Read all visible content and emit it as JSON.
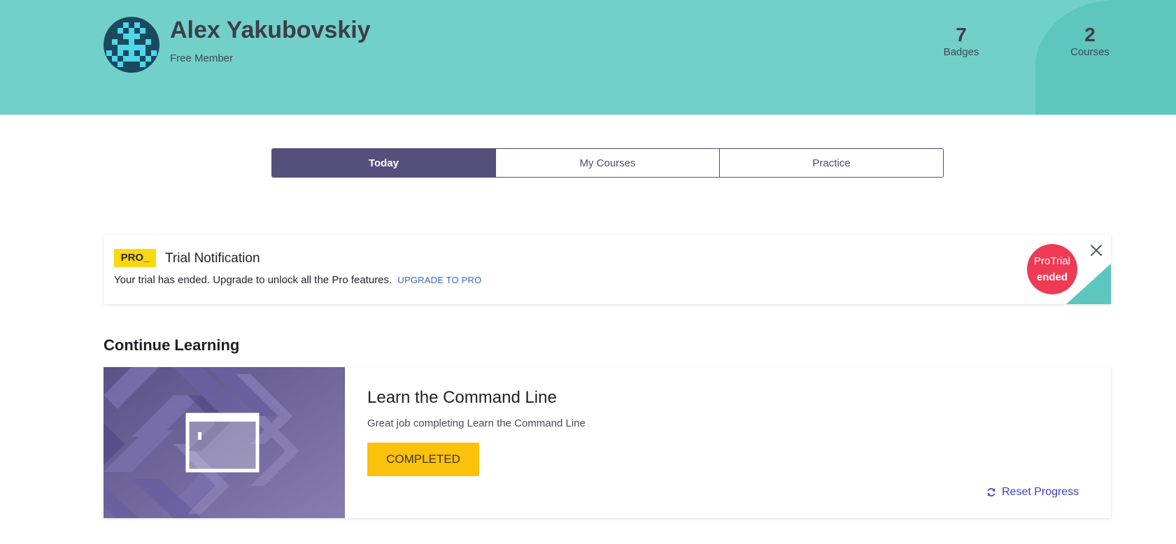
{
  "header": {
    "user_name": "Alex Yakubovskiy",
    "membership": "Free Member",
    "stats": [
      {
        "value": "7",
        "label": "Badges"
      },
      {
        "value": "2",
        "label": "Courses"
      }
    ]
  },
  "tabs": [
    {
      "label": "Today",
      "active": true
    },
    {
      "label": "My Courses",
      "active": false
    },
    {
      "label": "Practice",
      "active": false
    }
  ],
  "notification": {
    "badge": "PRO_",
    "title": "Trial Notification",
    "message": "Your trial has ended. Upgrade to unlock all the Pro features.",
    "link_label": "UPGRADE TO PRO",
    "status_line1": "ProTrial",
    "status_line2": "ended",
    "close_icon": "close-icon"
  },
  "continue_learning": {
    "section_title": "Continue Learning",
    "course": {
      "title": "Learn the Command Line",
      "description": "Great job completing Learn the Command Line",
      "status_button": "COMPLETED",
      "reset_label": "Reset Progress",
      "reset_icon": "refresh-icon"
    }
  },
  "colors": {
    "header_teal": "#72d0ca",
    "tab_active": "#554f7c",
    "pro_yellow": "#fcd80f",
    "trial_red": "#ef3a55",
    "completed_yellow": "#fbc10b",
    "link_blue": "#3a63cc",
    "reset_blue": "#3b3fc4"
  }
}
